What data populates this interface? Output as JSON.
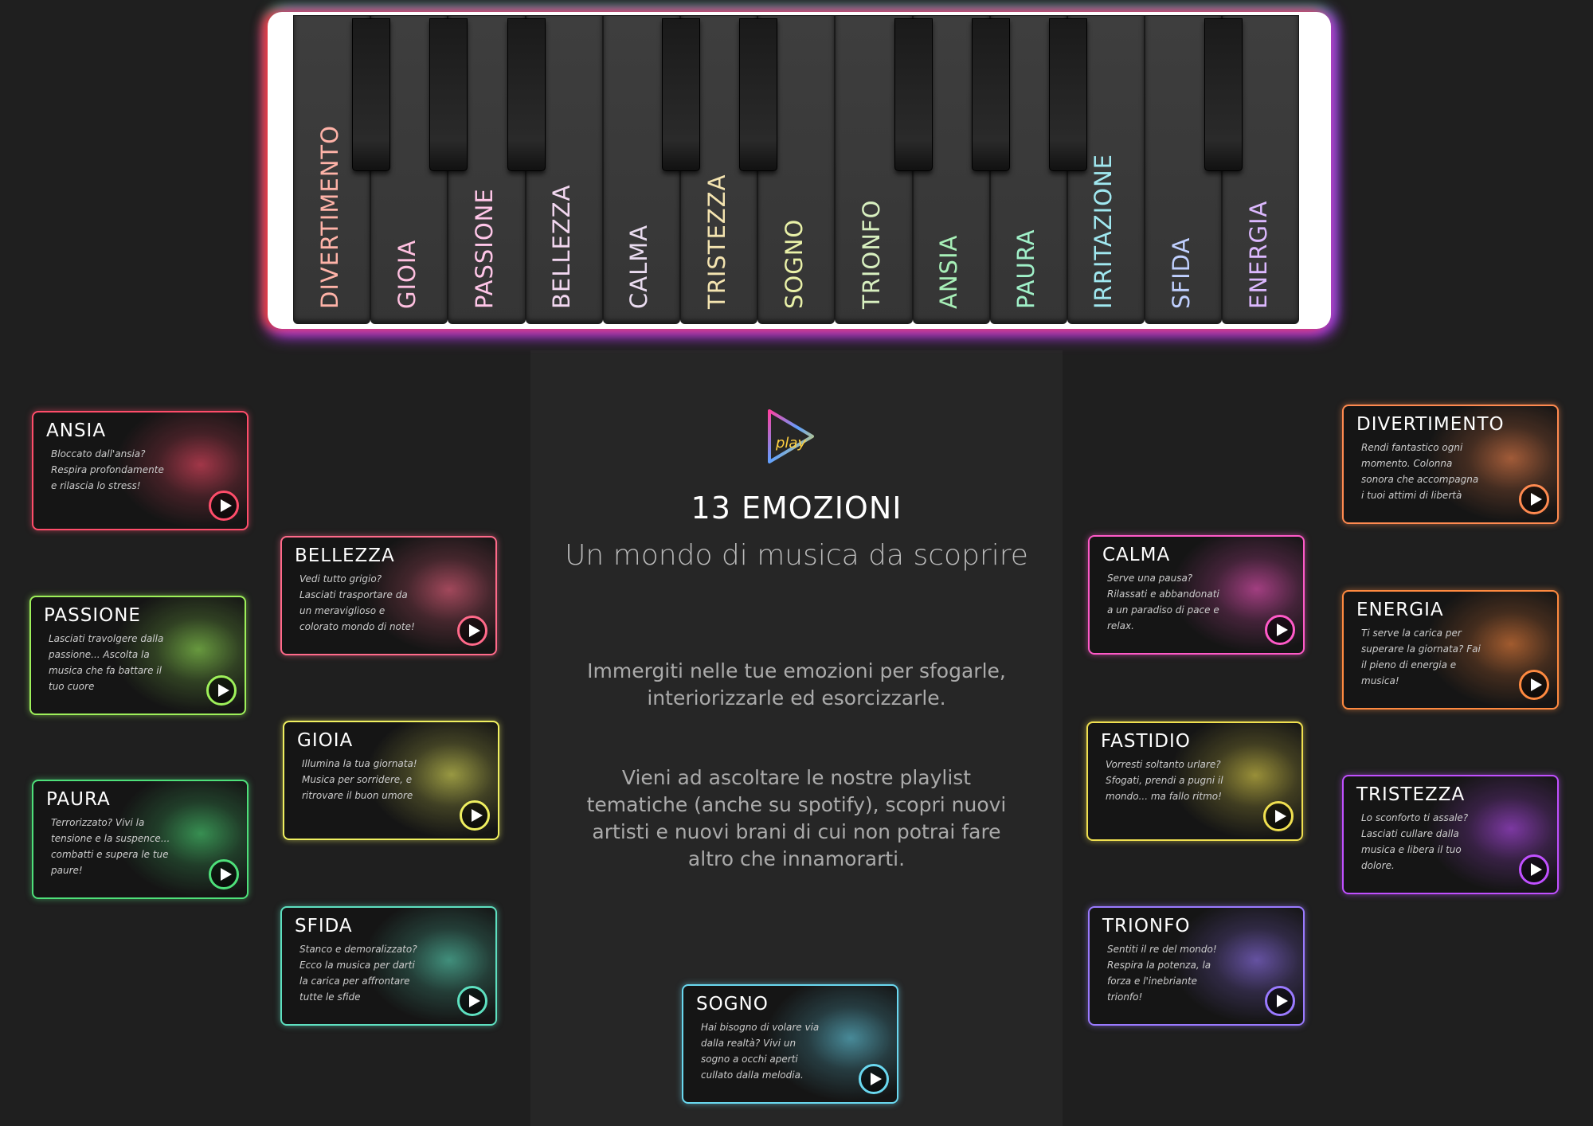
{
  "piano": {
    "keys": [
      {
        "label": "DIVERTIMENTO",
        "color": "#ffb3a8"
      },
      {
        "label": "GIOIA",
        "color": "#ffc0e0"
      },
      {
        "label": "PASSIONE",
        "color": "#ffc6e8"
      },
      {
        "label": "BELLEZZA",
        "color": "#f2d7f0"
      },
      {
        "label": "CALMA",
        "color": "#eadcf0"
      },
      {
        "label": "TRISTEZZA",
        "color": "#f4e4b0"
      },
      {
        "label": "SOGNO",
        "color": "#e9f1a8"
      },
      {
        "label": "TRIONFO",
        "color": "#d8f0c0"
      },
      {
        "label": "ANSIA",
        "color": "#a8f0b8"
      },
      {
        "label": "PAURA",
        "color": "#a0f0c8"
      },
      {
        "label": "IRRITAZIONE",
        "color": "#a0e8f0"
      },
      {
        "label": "SFIDA",
        "color": "#c0d0ff"
      },
      {
        "label": "ENERGIA",
        "color": "#dcb8ff"
      }
    ]
  },
  "hero": {
    "logo_text": "play",
    "title": "13 EMOZIONI",
    "subtitle": "Un mondo di musica da scoprire",
    "paragraph1": "Immergiti nelle tue emozioni per sfogarle, interiorizzarle ed esorcizzarle.",
    "paragraph2": "Vieni ad ascoltare le nostre playlist tematiche (anche su spotify), scopri nuovi artisti e nuovi brani di cui non potrai fare altro che innamorarti."
  },
  "cards": {
    "ansia": {
      "title": "ANSIA",
      "desc": "Bloccato dall'ansia? Respira profondamente e rilascia lo stress!",
      "color": "#ff4d6a"
    },
    "passione": {
      "title": "PASSIONE",
      "desc": "Lasciati travolgere dalla passione... Ascolta la musica che fa battare il tuo cuore",
      "color": "#9ef05a"
    },
    "paura": {
      "title": "PAURA",
      "desc": "Terrorizzato? Vivi la tensione e la suspence... combatti e supera le tue paure!",
      "color": "#4ee07a"
    },
    "bellezza": {
      "title": "BELLEZZA",
      "desc": "Vedi tutto grigio? Lasciati trasportare da un meraviglioso e colorato mondo di note!",
      "color": "#ff6a8a"
    },
    "gioia": {
      "title": "GIOIA",
      "desc": "Illumina la tua giornata! Musica per sorridere, e ritrovare il buon umore",
      "color": "#f0f060"
    },
    "sfida": {
      "title": "SFIDA",
      "desc": "Stanco e demoralizzato? Ecco la musica per darti la carica per affrontare tutte le sfide",
      "color": "#5ee0c0"
    },
    "sogno": {
      "title": "SOGNO",
      "desc": "Hai bisogno di volare via dalla realtà? Vivi un sogno a occhi aperti cullato dalla melodia.",
      "color": "#6ad8f0"
    },
    "calma": {
      "title": "CALMA",
      "desc": "Serve una pausa? Rilassati e abbandonati a un paradiso di pace e relax.",
      "color": "#ff5ac8"
    },
    "fastidio": {
      "title": "FASTIDIO",
      "desc": "Vorresti soltanto urlare? Sfogati, prendi a pugni il mondo... ma fallo ritmo!",
      "color": "#f0e050"
    },
    "trionfo": {
      "title": "TRIONFO",
      "desc": "Sentiti il re del mondo! Respira la potenza, la forza e l'inebriante trionfo!",
      "color": "#9a7aff"
    },
    "divertimento": {
      "title": "DIVERTIMENTO",
      "desc": "Rendi fantastico ogni momento. Colonna sonora che accompagna i tuoi attimi di libertà",
      "color": "#ff8a50"
    },
    "energia": {
      "title": "ENERGIA",
      "desc": "Ti serve la carica per superare la giornata? Fai il pieno di energia e musica!",
      "color": "#ff8a40"
    },
    "tristezza": {
      "title": "TRISTEZZA",
      "desc": "Lo sconforto ti assale? Lasciati cullare dalla musica e libera il tuo dolore.",
      "color": "#c050ff"
    }
  }
}
